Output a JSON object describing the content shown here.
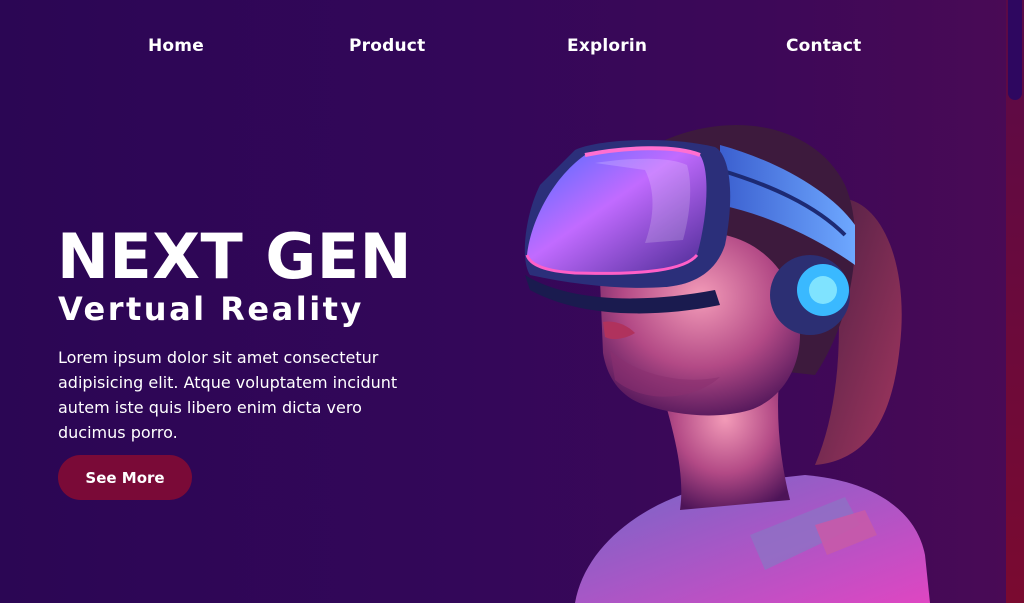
{
  "nav": {
    "home": "Home",
    "product": "Product",
    "explore": "Explorin",
    "contact": "Contact"
  },
  "hero": {
    "title": "NEXT GEN",
    "subtitle": "Vertual Reality",
    "description": "Lorem ipsum dolor sit amet consectetur adipisicing elit. Atque voluptatem incidunt autem iste quis libero enim dicta vero ducimus porro.",
    "button": "See More",
    "image_icon": "vr-headset-woman-illustration"
  },
  "colors": {
    "background_start": "#2b0654",
    "background_end": "#4a0a55",
    "button": "#7a0a37",
    "headset_glow": "#5aa9ff",
    "accent_pink": "#ff3fb4"
  }
}
